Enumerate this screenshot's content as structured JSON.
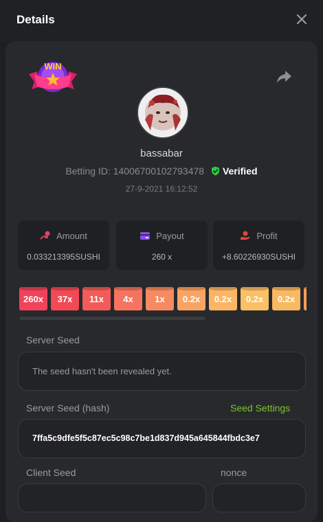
{
  "header": {
    "title": "Details"
  },
  "user": {
    "name": "bassabar",
    "betting_id_label": "Betting ID: 14006700102793478",
    "verified_label": "Verified",
    "datetime": "27-9-2021 16:12:52"
  },
  "badge": {
    "text": "WIN"
  },
  "stats": {
    "amount": {
      "label": "Amount",
      "value": "0.033213395SUSHI"
    },
    "payout": {
      "label": "Payout",
      "value": "260 x"
    },
    "profit": {
      "label": "Profit",
      "value": "+8.60226930SUSHI"
    }
  },
  "multipliers": [
    {
      "label": "260x",
      "color": "#f0435a"
    },
    {
      "label": "37x",
      "color": "#f14a55"
    },
    {
      "label": "11x",
      "color": "#f25c58"
    },
    {
      "label": "4x",
      "color": "#f57460"
    },
    {
      "label": "1x",
      "color": "#f78a62"
    },
    {
      "label": "0.2x",
      "color": "#f9a463"
    },
    {
      "label": "0.2x",
      "color": "#fbb564"
    },
    {
      "label": "0.2x",
      "color": "#fbbf66"
    },
    {
      "label": "0.2x",
      "color": "#f9b862"
    },
    {
      "label": "",
      "color": "#f59f55"
    }
  ],
  "server_seed": {
    "label": "Server Seed",
    "value": "The seed hasn't been revealed yet."
  },
  "server_seed_hash": {
    "label": "Server Seed (hash)",
    "value": "7ffa5c9dfe5f5c87ec5c98c7be1d837d945a645844fbdc3e7",
    "settings_label": "Seed Settings"
  },
  "client_seed": {
    "label": "Client Seed"
  },
  "nonce": {
    "label": "nonce"
  },
  "colors": {
    "accent_green": "#7cc52b",
    "verified_green": "#2ecc40",
    "panel": "#28292d",
    "background": "#1e1f22"
  }
}
